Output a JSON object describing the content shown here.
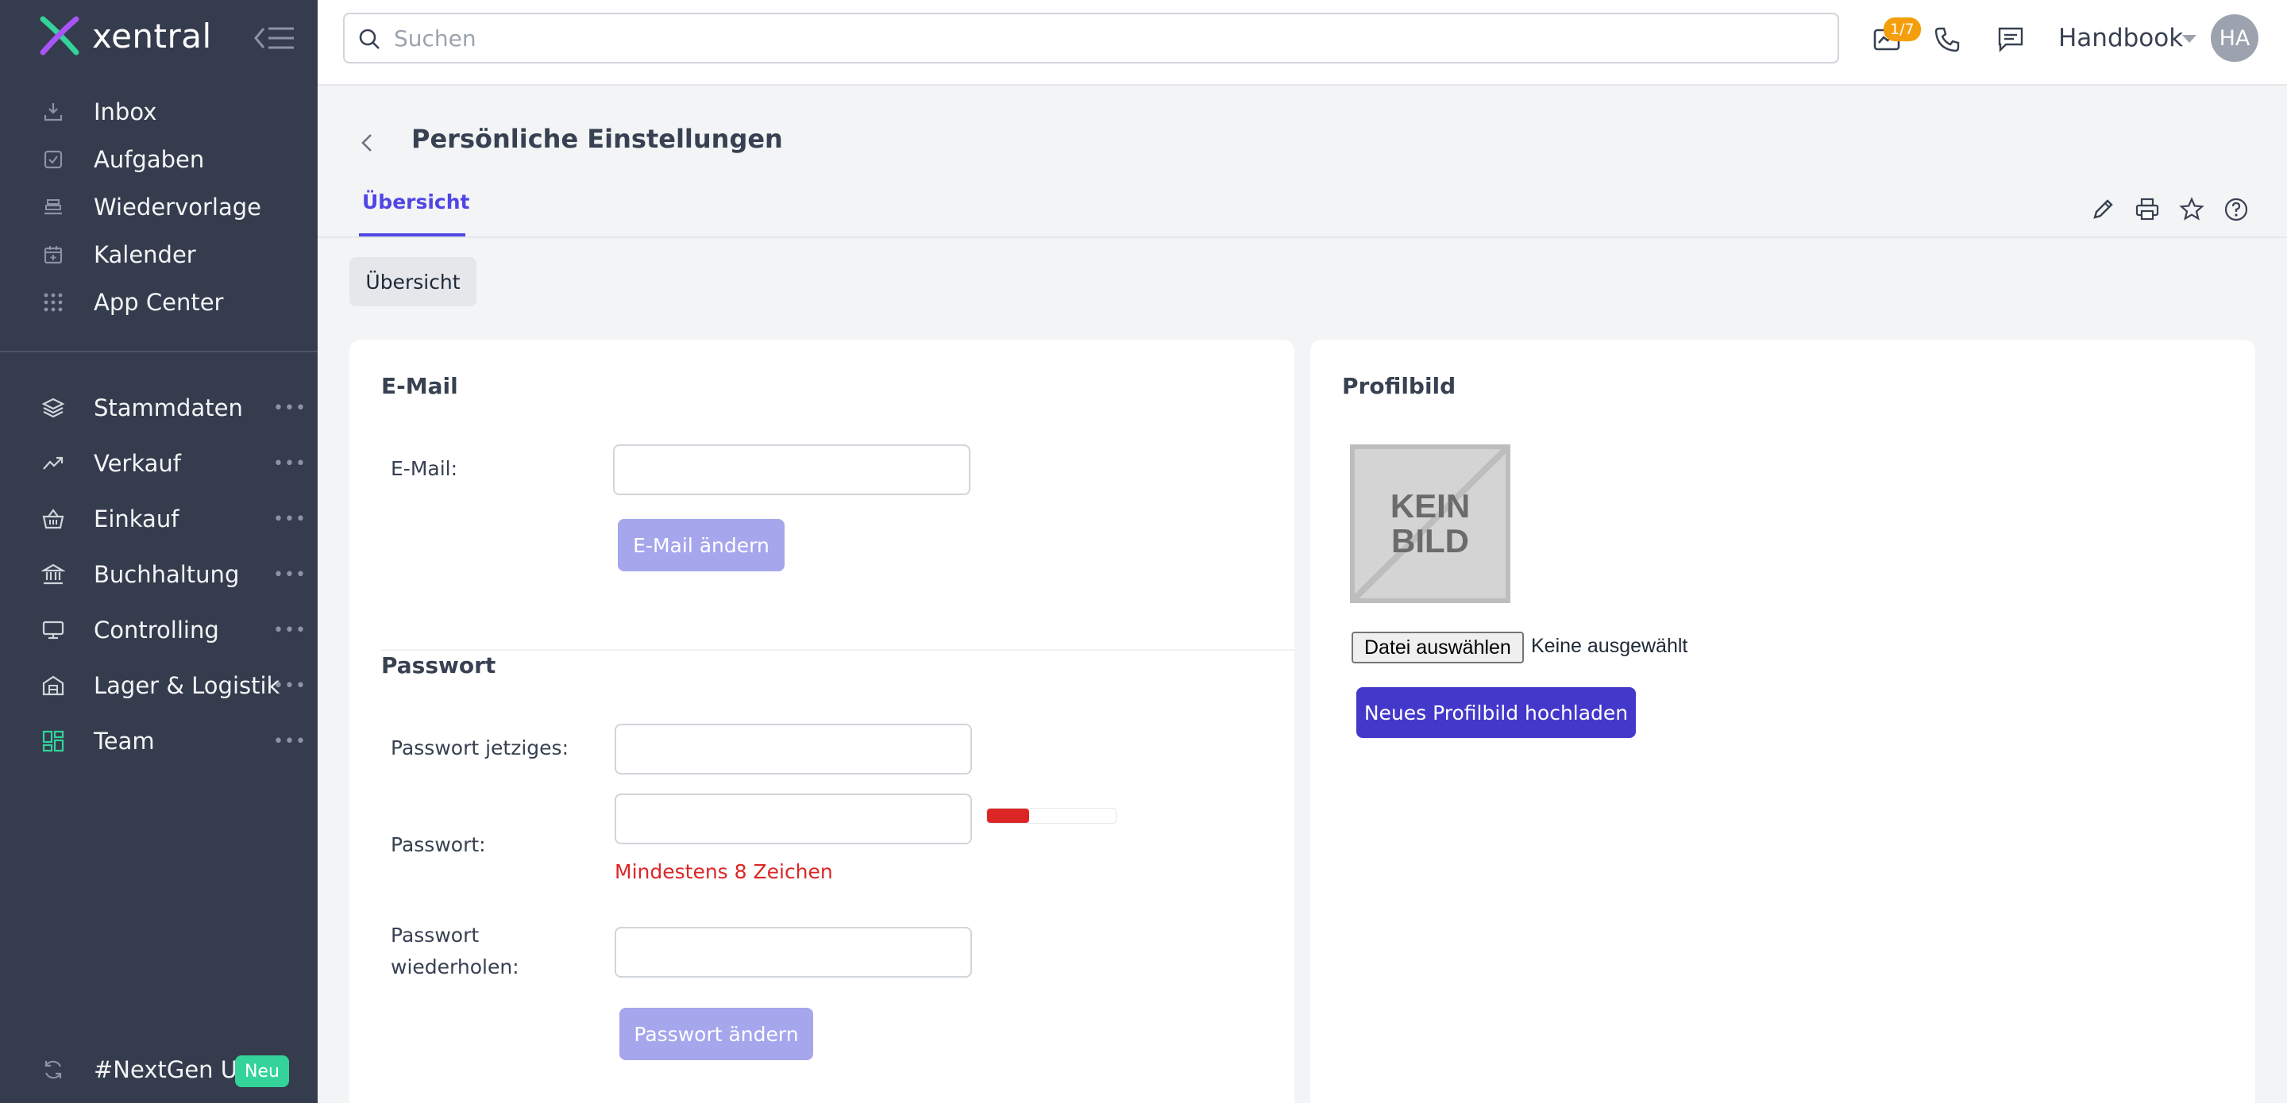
{
  "app": {
    "name": "xentral"
  },
  "sidebar": {
    "primary": [
      {
        "label": "Inbox",
        "icon": "inbox-icon"
      },
      {
        "label": "Aufgaben",
        "icon": "task-icon"
      },
      {
        "label": "Wiedervorlage",
        "icon": "stack-icon"
      },
      {
        "label": "Kalender",
        "icon": "calendar-icon"
      },
      {
        "label": "App Center",
        "icon": "grid-icon"
      }
    ],
    "modules": [
      {
        "label": "Stammdaten",
        "icon": "layers-icon",
        "more": "•••"
      },
      {
        "label": "Verkauf",
        "icon": "trend-icon",
        "more": "•••"
      },
      {
        "label": "Einkauf",
        "icon": "basket-icon",
        "more": "•••"
      },
      {
        "label": "Buchhaltung",
        "icon": "bank-icon",
        "more": "•••"
      },
      {
        "label": "Controlling",
        "icon": "monitor-icon",
        "more": "•••"
      },
      {
        "label": "Lager & Logistik",
        "icon": "warehouse-icon",
        "more": "•••"
      },
      {
        "label": "Team",
        "icon": "team-icon",
        "more": "•••"
      }
    ],
    "footer": {
      "label": "#NextGen UI",
      "badge": "Neu"
    }
  },
  "topbar": {
    "search_placeholder": "Suchen",
    "notification_badge": "1/7",
    "workspace": "Handbook",
    "avatar_initials": "HA"
  },
  "header": {
    "title": "Persönliche Einstellungen",
    "tab": "Übersicht"
  },
  "subtab": "Übersicht",
  "email_section": {
    "title": "E-Mail",
    "label": "E-Mail:",
    "value": "",
    "button": "E-Mail ändern"
  },
  "password_section": {
    "title": "Passwort",
    "current_label": "Passwort jetziges:",
    "new_label": "Passwort:",
    "hint": "Mindestens 8 Zeichen",
    "repeat_label_line1": "Passwort",
    "repeat_label_line2": "wiederholen:",
    "button": "Passwort ändern",
    "strength_fraction": 0.33
  },
  "profile_section": {
    "title": "Profilbild",
    "placeholder_line1": "KEIN",
    "placeholder_line2": "BILD",
    "file_button": "Datei auswählen",
    "file_status": "Keine ausgewählt",
    "upload_button": "Neues Profilbild hochladen"
  },
  "colors": {
    "sidebar_bg": "#343c4d",
    "accent": "#4338ca",
    "accent_disabled": "#a5a6ec",
    "error": "#dc2626",
    "team_active": "#34d399"
  }
}
